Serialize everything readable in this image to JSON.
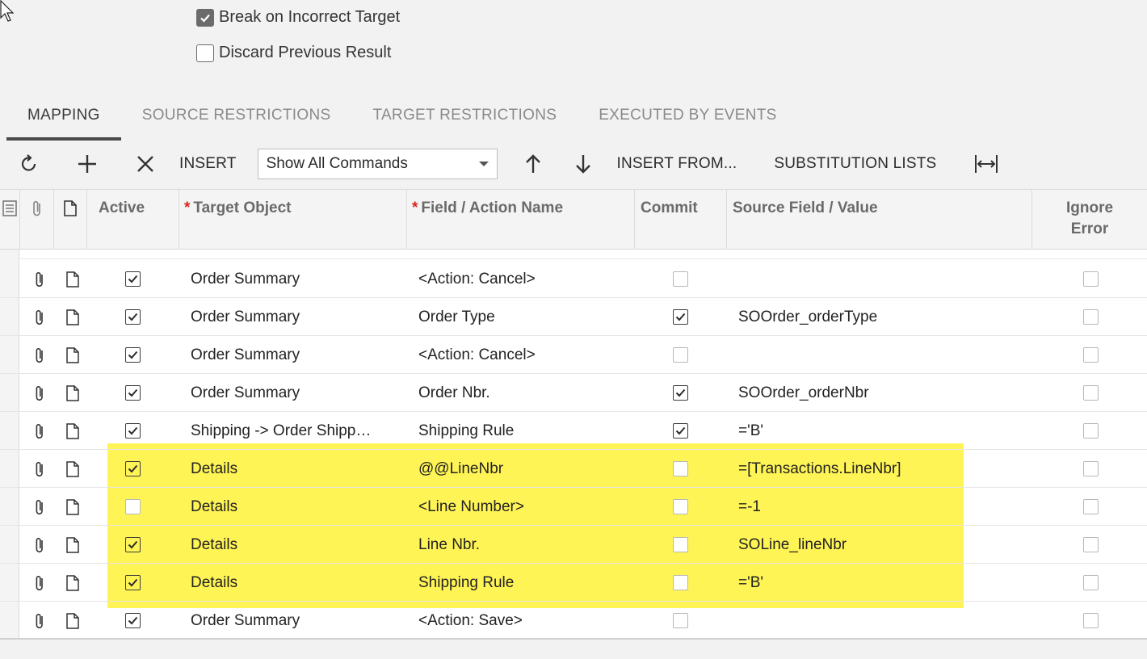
{
  "options": {
    "break_label": "Break on Incorrect Target",
    "break_checked": true,
    "discard_label": "Discard Previous Result",
    "discard_checked": false
  },
  "tabs": [
    {
      "label": "MAPPING",
      "active": true
    },
    {
      "label": "SOURCE RESTRICTIONS",
      "active": false
    },
    {
      "label": "TARGET RESTRICTIONS",
      "active": false
    },
    {
      "label": "EXECUTED BY EVENTS",
      "active": false
    }
  ],
  "toolbar": {
    "insert_label": "INSERT",
    "commands_select": "Show All Commands",
    "insert_from_label": "INSERT FROM...",
    "substitution_label": "SUBSTITUTION LISTS",
    "icons": [
      "refresh-icon",
      "add-icon",
      "delete-icon",
      "arrow-up-icon",
      "arrow-down-icon",
      "fit-columns-icon"
    ]
  },
  "columns": {
    "active": "Active",
    "target_object": "Target Object",
    "field_action": "Field / Action Name",
    "commit": "Commit",
    "source_field": "Source Field / Value",
    "ignore_error": "Ignore Error"
  },
  "rows": [
    {
      "active": true,
      "target": "Order Summary",
      "field": "<Action: Cancel>",
      "commit": false,
      "source": "",
      "ignore": false
    },
    {
      "active": true,
      "target": "Order Summary",
      "field": "Order Type",
      "commit": true,
      "source": "SOOrder_orderType",
      "ignore": false
    },
    {
      "active": true,
      "target": "Order Summary",
      "field": "<Action: Cancel>",
      "commit": false,
      "source": "",
      "ignore": false
    },
    {
      "active": true,
      "target": "Order Summary",
      "field": "Order Nbr.",
      "commit": true,
      "source": "SOOrder_orderNbr",
      "ignore": false
    },
    {
      "active": true,
      "target": "Shipping -> Order Shipp…",
      "field": "Shipping Rule",
      "commit": true,
      "source": "='B'",
      "ignore": false
    },
    {
      "active": true,
      "target": "Details",
      "field": "@@LineNbr",
      "commit": false,
      "source": "=[Transactions.LineNbr]",
      "ignore": false
    },
    {
      "active": false,
      "target": "Details",
      "field": "<Line Number>",
      "commit": false,
      "source": "=-1",
      "ignore": false
    },
    {
      "active": true,
      "target": "Details",
      "field": "Line Nbr.",
      "commit": false,
      "source": "SOLine_lineNbr",
      "ignore": false
    },
    {
      "active": true,
      "target": "Details",
      "field": "Shipping Rule",
      "commit": false,
      "source": "='B'",
      "ignore": false
    },
    {
      "active": true,
      "target": "Order Summary",
      "field": "<Action: Save>",
      "commit": false,
      "source": "",
      "ignore": false
    }
  ],
  "highlight_color": "#fff455"
}
